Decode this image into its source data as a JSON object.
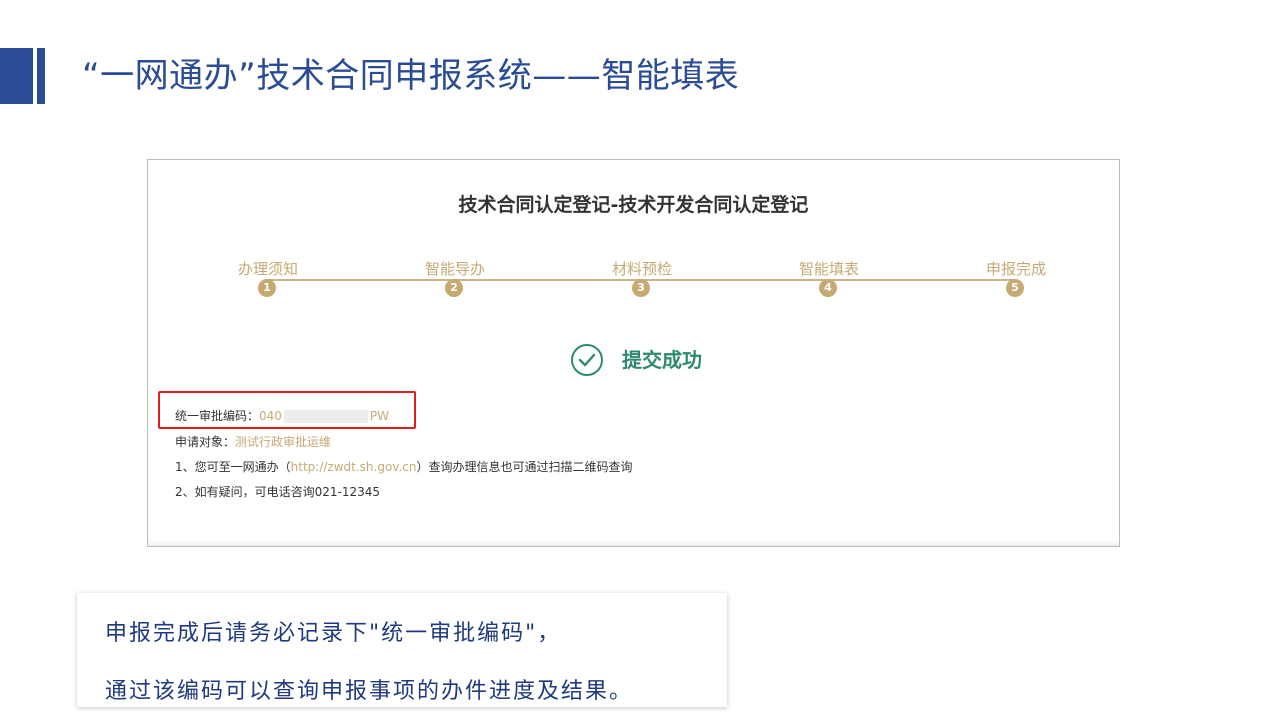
{
  "slide": {
    "title": "“一网通办”技术合同申报系统——智能填表"
  },
  "form": {
    "title": "技术合同认定登记-技术开发合同认定登记",
    "steps": [
      {
        "label": "办理须知",
        "num": "1"
      },
      {
        "label": "智能导办",
        "num": "2"
      },
      {
        "label": "材料预检",
        "num": "3"
      },
      {
        "label": "智能填表",
        "num": "4"
      },
      {
        "label": "申报完成",
        "num": "5"
      }
    ],
    "success_text": "提交成功",
    "code": {
      "label": "统一审批编码：",
      "prefix": "040",
      "suffix": "PW"
    },
    "applicant": {
      "label": "申请对象：",
      "value": "测试行政审批运维"
    },
    "notes": {
      "note1_prefix": "1、您可至一网通办（",
      "note1_link": "http://zwdt.sh.gov.cn",
      "note1_suffix": "）查询办理信息也可通过扫描二维码查询",
      "note2": "2、如有疑问，可电话咨询021-12345"
    }
  },
  "callout": {
    "line1": "申报完成后请务必记录下\"统一审批编码\"，",
    "line2": "通过该编码可以查询申报事项的办件进度及结果。"
  },
  "colors": {
    "title_blue": "#2a4b96",
    "step_gold": "#c6aa74",
    "success_green": "#2d8a6e",
    "highlight_red": "#e02020"
  }
}
